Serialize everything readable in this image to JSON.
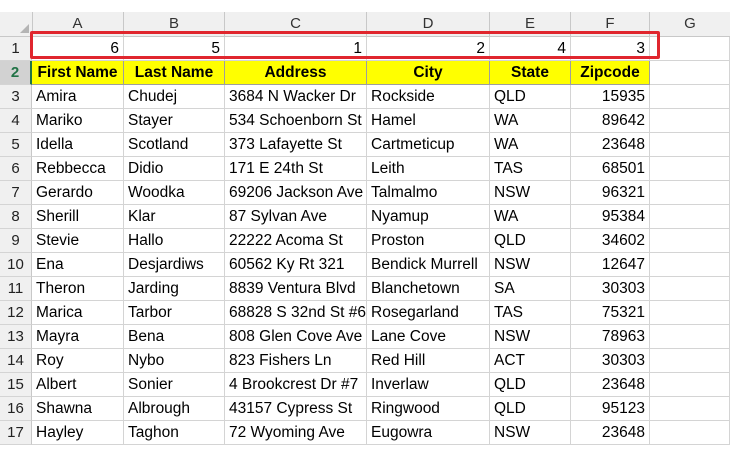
{
  "columns": [
    "A",
    "B",
    "C",
    "D",
    "E",
    "F",
    "G"
  ],
  "order_row": {
    "row_num": "1",
    "values": [
      "6",
      "5",
      "1",
      "2",
      "4",
      "3"
    ]
  },
  "header_row": {
    "row_num": "2",
    "labels": [
      "First Name",
      "Last Name",
      "Address",
      "City",
      "State",
      "Zipcode"
    ]
  },
  "rows": [
    {
      "n": "3",
      "first": "Amira",
      "last": "Chudej",
      "address": "3684 N Wacker Dr",
      "city": "Rockside",
      "state": "QLD",
      "zip": "15935"
    },
    {
      "n": "4",
      "first": "Mariko",
      "last": "Stayer",
      "address": "534 Schoenborn St",
      "city": "Hamel",
      "state": "WA",
      "zip": "89642"
    },
    {
      "n": "5",
      "first": "Idella",
      "last": "Scotland",
      "address": "373 Lafayette St",
      "city": "Cartmeticup",
      "state": "WA",
      "zip": "23648"
    },
    {
      "n": "6",
      "first": "Rebbecca",
      "last": "Didio",
      "address": "171 E 24th St",
      "city": "Leith",
      "state": "TAS",
      "zip": "68501"
    },
    {
      "n": "7",
      "first": "Gerardo",
      "last": "Woodka",
      "address": "69206 Jackson Ave",
      "city": "Talmalmo",
      "state": "NSW",
      "zip": "96321"
    },
    {
      "n": "8",
      "first": "Sherill",
      "last": "Klar",
      "address": "87 Sylvan Ave",
      "city": "Nyamup",
      "state": "WA",
      "zip": "95384"
    },
    {
      "n": "9",
      "first": "Stevie",
      "last": "Hallo",
      "address": "22222 Acoma St",
      "city": "Proston",
      "state": "QLD",
      "zip": "34602"
    },
    {
      "n": "10",
      "first": "Ena",
      "last": "Desjardiws",
      "address": "60562 Ky Rt 321",
      "city": "Bendick Murrell",
      "state": "NSW",
      "zip": "12647"
    },
    {
      "n": "11",
      "first": "Theron",
      "last": "Jarding",
      "address": "8839 Ventura Blvd",
      "city": "Blanchetown",
      "state": "SA",
      "zip": "30303"
    },
    {
      "n": "12",
      "first": "Marica",
      "last": "Tarbor",
      "address": "68828 S 32nd St #6",
      "city": "Rosegarland",
      "state": "TAS",
      "zip": "75321"
    },
    {
      "n": "13",
      "first": "Mayra",
      "last": "Bena",
      "address": "808 Glen Cove Ave",
      "city": "Lane Cove",
      "state": "NSW",
      "zip": "78963"
    },
    {
      "n": "14",
      "first": "Roy",
      "last": "Nybo",
      "address": "823 Fishers Ln",
      "city": "Red Hill",
      "state": "ACT",
      "zip": "30303"
    },
    {
      "n": "15",
      "first": "Albert",
      "last": "Sonier",
      "address": "4 Brookcrest Dr #7",
      "city": "Inverlaw",
      "state": "QLD",
      "zip": "23648"
    },
    {
      "n": "16",
      "first": "Shawna",
      "last": "Albrough",
      "address": "43157 Cypress St",
      "city": "Ringwood",
      "state": "QLD",
      "zip": "95123"
    },
    {
      "n": "17",
      "first": "Hayley",
      "last": "Taghon",
      "address": "72 Wyoming Ave",
      "city": "Eugowra",
      "state": "NSW",
      "zip": "23648"
    }
  ],
  "colors": {
    "header_fill": "#ffff00",
    "highlight_border": "#e0262e",
    "grid": "#d4d4d4",
    "excel_green": "#217346"
  }
}
